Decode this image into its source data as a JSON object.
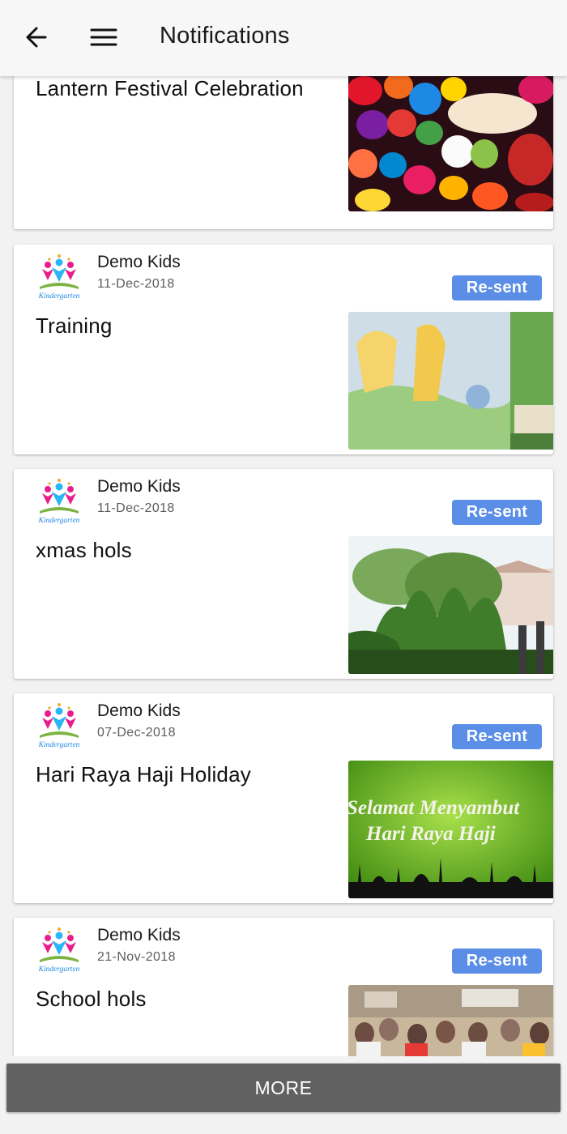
{
  "header": {
    "title": "Notifications",
    "back_icon": "arrow-left-icon",
    "menu_icon": "hamburger-menu-icon"
  },
  "colors": {
    "badge": "#5b8ee6",
    "more_button": "#616161",
    "app_bar": "#f7f7f7"
  },
  "notifications": [
    {
      "title": "Lantern Festival Celebration",
      "image": "lanterns-photo"
    },
    {
      "sender": "Demo Kids",
      "date": "11-Dec-2018",
      "badge": "Re-sent",
      "title": "Training",
      "image": "classroom-mural-photo"
    },
    {
      "sender": "Demo Kids",
      "date": "11-Dec-2018",
      "badge": "Re-sent",
      "title": "xmas hols",
      "image": "garden-plants-photo"
    },
    {
      "sender": "Demo Kids",
      "date": "07-Dec-2018",
      "badge": "Re-sent",
      "title": "Hari Raya Haji Holiday",
      "image": "greeting-card-image",
      "image_text": [
        "Selamat Menyambut",
        "Hari Raya Haji"
      ]
    },
    {
      "sender": "Demo Kids",
      "date": "21-Nov-2018",
      "badge": "Re-sent",
      "title": "School hols",
      "image": "school-children-photo"
    }
  ],
  "footer": {
    "more_label": "MORE"
  }
}
